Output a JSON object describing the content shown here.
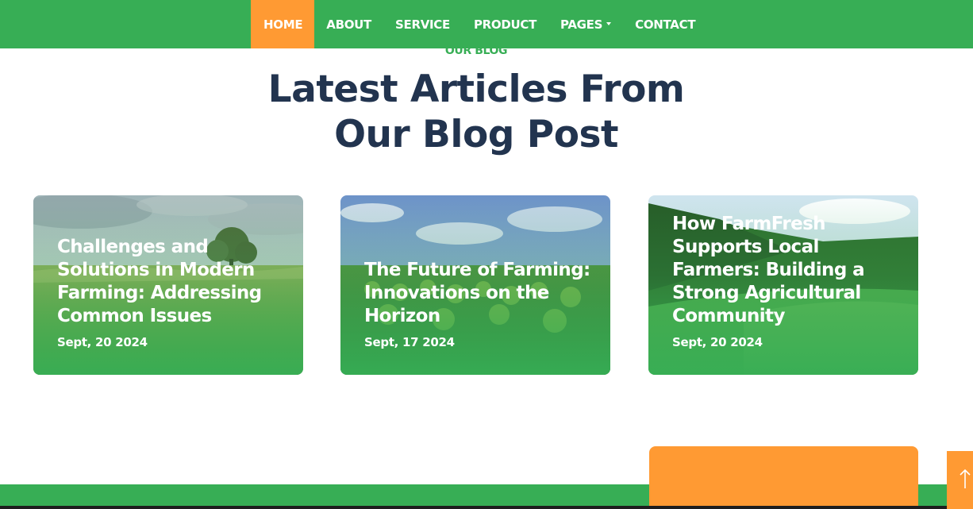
{
  "nav": {
    "items": [
      {
        "label": "HOME",
        "active": true
      },
      {
        "label": "ABOUT"
      },
      {
        "label": "SERVICE"
      },
      {
        "label": "PRODUCT"
      },
      {
        "label": "PAGES",
        "dropdown": true
      },
      {
        "label": "CONTACT"
      }
    ]
  },
  "section": {
    "eyebrow": "OUR BLOG",
    "title_line1": "Latest Articles From",
    "title_line2": "Our Blog Post"
  },
  "posts": [
    {
      "title": "Challenges and Solutions in Modern Farming: Addressing Common Issues",
      "date": "Sept, 20 2024",
      "image": "wheat-field-with-tree"
    },
    {
      "title": "The Future of Farming: Innovations on the Horizon",
      "date": "Sept, 17 2024",
      "image": "crop-rows-farm"
    },
    {
      "title": "How FarmFresh Supports Local Farmers: Building a Strong Agricultural Community",
      "date": "Sept, 20 2024",
      "image": "green-hills-landscape"
    }
  ],
  "colors": {
    "brand_green": "#37ae55",
    "accent_orange": "#ff9a33",
    "heading_navy": "#22344f"
  },
  "icons": {
    "scroll_top": "arrow-up-icon"
  }
}
